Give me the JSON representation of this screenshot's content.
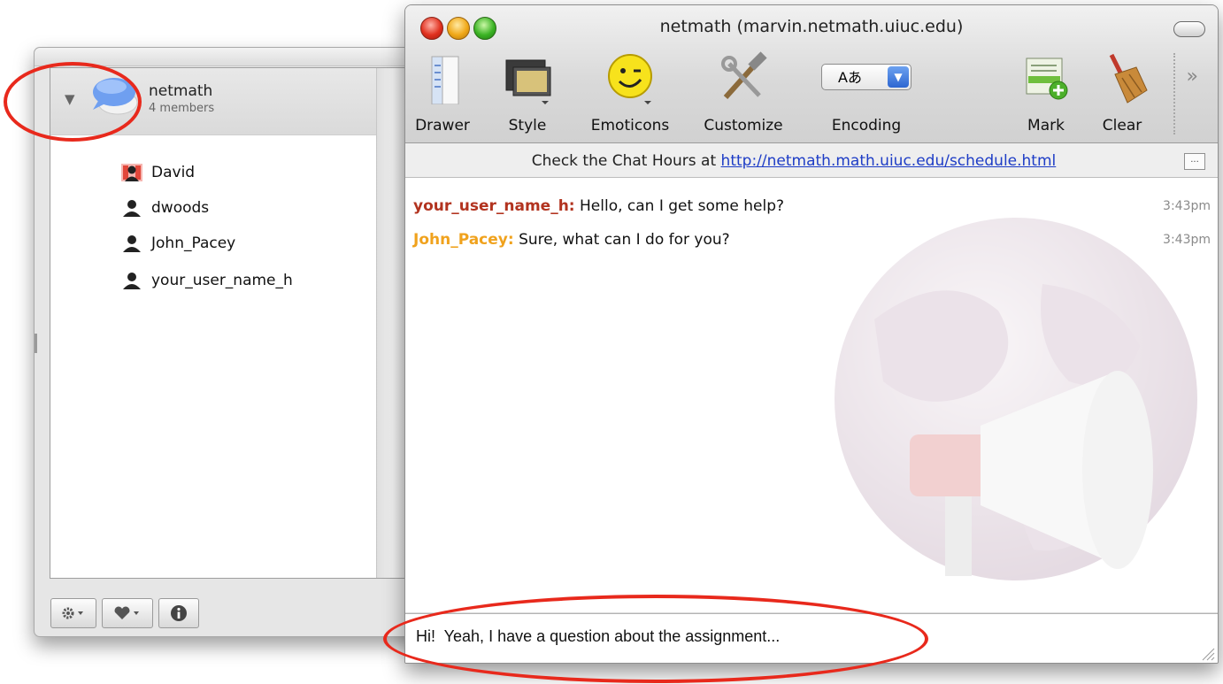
{
  "contacts": {
    "group": {
      "name": "netmath",
      "count": "4 members"
    },
    "members": [
      "David",
      "dwoods",
      "John_Pacey",
      "your_user_name_h"
    ],
    "icons": [
      "gear-icon",
      "heart-icon",
      "info-icon"
    ]
  },
  "chat": {
    "title": "netmath (marvin.netmath.uiuc.edu)",
    "toolbar": {
      "drawer": "Drawer",
      "style": "Style",
      "emoticons": "Emoticons",
      "customize": "Customize",
      "encoding": "Encoding",
      "encoding_value": "Aあ",
      "mark": "Mark",
      "clear": "Clear"
    },
    "topic": {
      "prefix": "Check the Chat Hours at ",
      "link": "http://netmath.math.uiuc.edu/schedule.html"
    },
    "messages": [
      {
        "sender": "your_user_name_h:",
        "text": " Hello, can I get some help?",
        "time": "3:43pm",
        "color": "#b2331f"
      },
      {
        "sender": "John_Pacey:",
        "text": " Sure, what can I do for you?",
        "time": "3:43pm",
        "color": "#f0a21d"
      }
    ],
    "input_value": "Hi!  Yeah, I have a question about the assignment..."
  },
  "colors": {
    "annotation": "#e8291c",
    "link": "#1d3cc6"
  }
}
